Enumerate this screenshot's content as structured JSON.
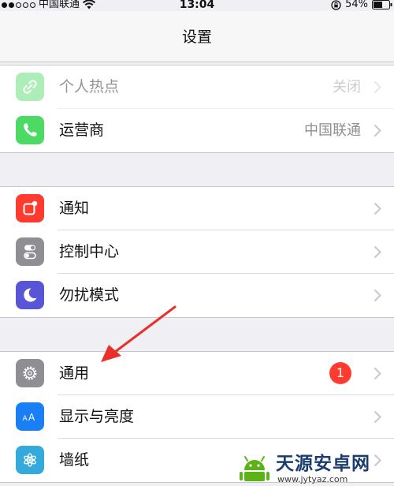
{
  "status_bar": {
    "carrier": "中国联通",
    "time": "13:04",
    "battery": "54%"
  },
  "nav": {
    "title": "设置"
  },
  "groups": [
    {
      "rows": [
        {
          "label": "个人热点",
          "value": "关闭",
          "icon": "hotspot-icon",
          "icon_color": "#4cd964"
        },
        {
          "label": "运营商",
          "value": "中国联通",
          "icon": "phone-icon",
          "icon_color": "#4cd964"
        }
      ]
    },
    {
      "rows": [
        {
          "label": "通知",
          "icon": "notification-icon",
          "icon_color": "#ff3b30"
        },
        {
          "label": "控制中心",
          "icon": "control-center-icon",
          "icon_color": "#8e8e93"
        },
        {
          "label": "勿扰模式",
          "icon": "moon-icon",
          "icon_color": "#5856d6"
        }
      ]
    },
    {
      "rows": [
        {
          "label": "通用",
          "badge": "1",
          "icon": "gear-icon",
          "icon_color": "#8e8e93"
        },
        {
          "label": "显示与亮度",
          "icon": "text-size-icon",
          "icon_color": "#1a7ef5"
        },
        {
          "label": "墙纸",
          "icon": "flower-icon",
          "icon_color": "#34aadc"
        }
      ]
    }
  ],
  "annotation": {
    "arrow_color": "#e8302a"
  },
  "watermark": {
    "title": "天源安卓网",
    "url": "www.jytyaz.com"
  }
}
